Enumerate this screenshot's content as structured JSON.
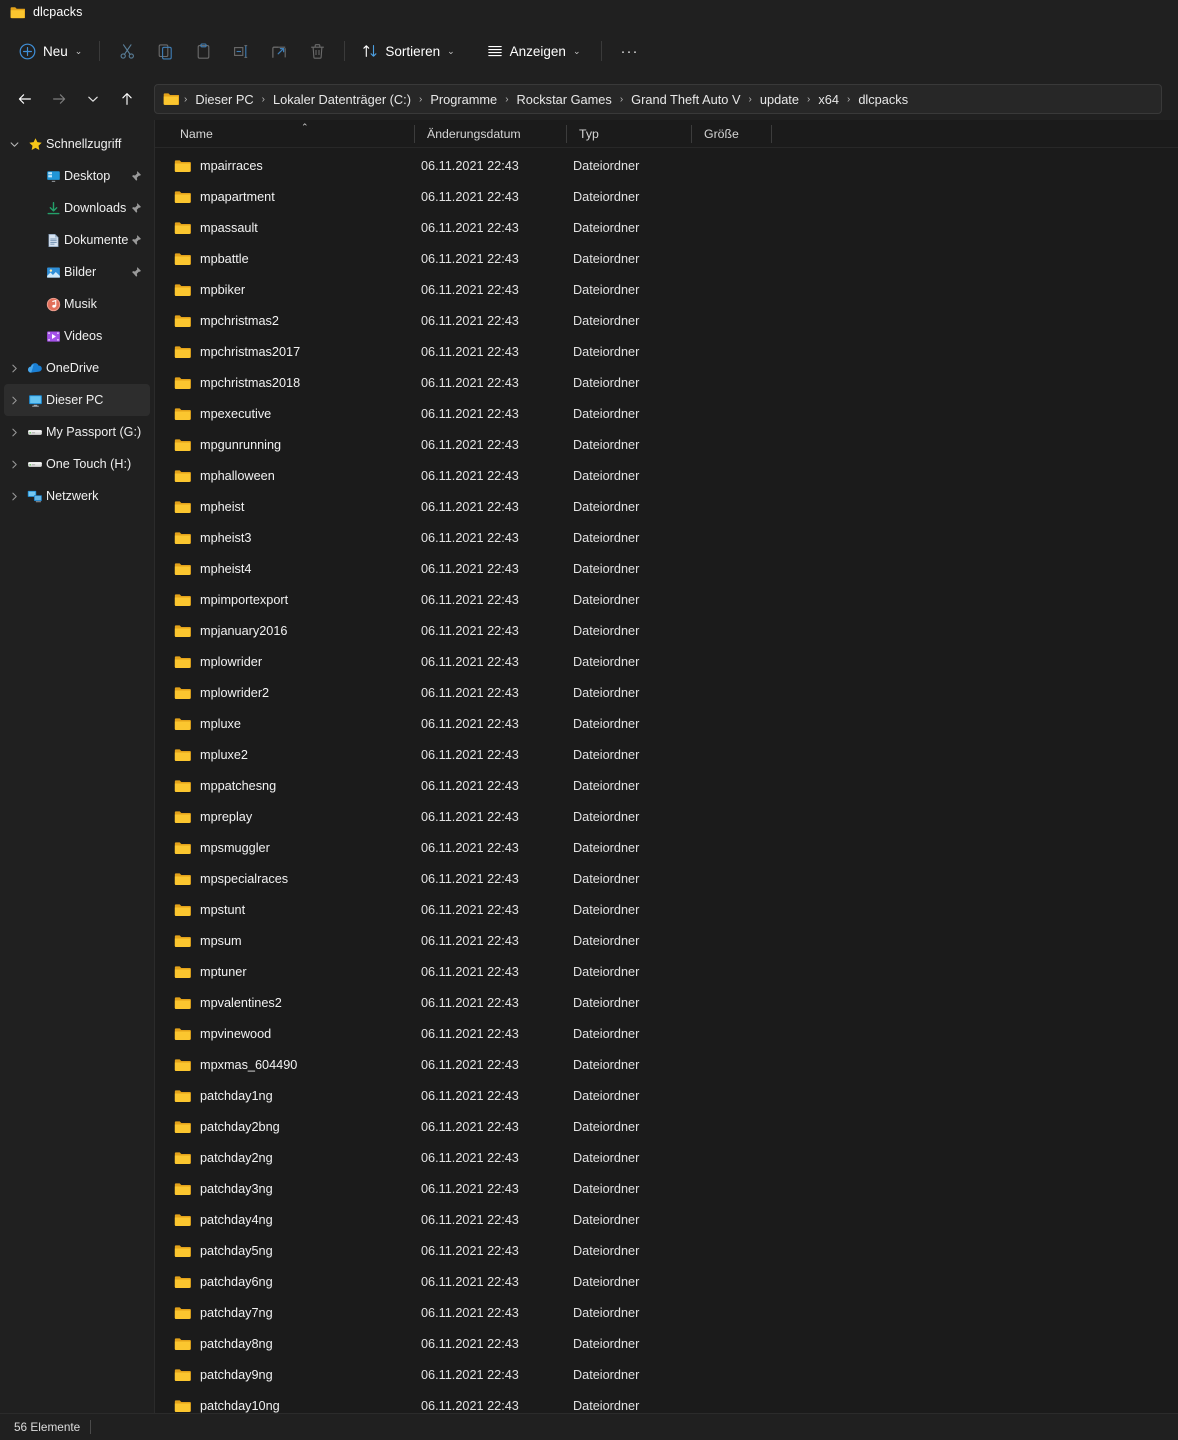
{
  "window": {
    "title": "dlcpacks",
    "folder_icon": "folder-icon"
  },
  "toolbar": {
    "new_label": "Neu",
    "new_icon": "plus-circle-icon",
    "cut_label": "Ausschneiden",
    "copy_label": "Kopieren",
    "paste_label": "Einfügen",
    "rename_label": "Umbenennen",
    "share_label": "Freigeben",
    "delete_label": "Löschen",
    "sort_label": "Sortieren",
    "sort_icon": "sort-arrows-icon",
    "view_label": "Anzeigen",
    "view_icon": "view-lines-icon",
    "more_label": "···"
  },
  "navbar": {
    "back_label": "Zurück",
    "forward_label": "Vorwärts",
    "recent_label": "Zuletzt verwendete Speicherorte",
    "up_label": "Nach oben",
    "breadcrumbs": [
      "Dieser PC",
      "Lokaler Datenträger (C:)",
      "Programme",
      "Rockstar Games",
      "Grand Theft Auto V",
      "update",
      "x64",
      "dlcpacks"
    ],
    "separator": "›"
  },
  "sidebar": {
    "items": [
      {
        "label": "Schnellzugriff",
        "icon": "star-icon",
        "expander": "down",
        "level": 0,
        "pinned": false,
        "selected": false
      },
      {
        "label": "Desktop",
        "icon": "desktop-icon",
        "expander": "none",
        "level": 1,
        "pinned": true,
        "selected": false
      },
      {
        "label": "Downloads",
        "icon": "download-icon",
        "expander": "none",
        "level": 1,
        "pinned": true,
        "selected": false
      },
      {
        "label": "Dokumente",
        "icon": "document-icon",
        "expander": "none",
        "level": 1,
        "pinned": true,
        "selected": false
      },
      {
        "label": "Bilder",
        "icon": "pictures-icon",
        "expander": "none",
        "level": 1,
        "pinned": true,
        "selected": false
      },
      {
        "label": "Musik",
        "icon": "music-icon",
        "expander": "none",
        "level": 1,
        "pinned": false,
        "selected": false
      },
      {
        "label": "Videos",
        "icon": "video-icon",
        "expander": "none",
        "level": 1,
        "pinned": false,
        "selected": false
      },
      {
        "label": "OneDrive",
        "icon": "cloud-icon",
        "expander": "right",
        "level": 0,
        "pinned": false,
        "selected": false
      },
      {
        "label": "Dieser PC",
        "icon": "monitor-icon",
        "expander": "right",
        "level": 0,
        "pinned": false,
        "selected": true
      },
      {
        "label": "My Passport (G:)",
        "icon": "drive-icon",
        "expander": "right",
        "level": 0,
        "pinned": false,
        "selected": false
      },
      {
        "label": "One Touch (H:)",
        "icon": "drive-icon",
        "expander": "right",
        "level": 0,
        "pinned": false,
        "selected": false
      },
      {
        "label": "Netzwerk",
        "icon": "network-icon",
        "expander": "right",
        "level": 0,
        "pinned": false,
        "selected": false
      }
    ]
  },
  "filelist": {
    "columns": [
      {
        "key": "name",
        "label": "Name",
        "sorted": "asc"
      },
      {
        "key": "date",
        "label": "Änderungsdatum",
        "sorted": "none"
      },
      {
        "key": "type",
        "label": "Typ",
        "sorted": "none"
      },
      {
        "key": "size",
        "label": "Größe",
        "sorted": "none"
      }
    ],
    "sort_indicator": "⌃",
    "rows": [
      {
        "name": "mpairraces",
        "date": "06.11.2021 22:43",
        "type": "Dateiordner",
        "size": ""
      },
      {
        "name": "mpapartment",
        "date": "06.11.2021 22:43",
        "type": "Dateiordner",
        "size": ""
      },
      {
        "name": "mpassault",
        "date": "06.11.2021 22:43",
        "type": "Dateiordner",
        "size": ""
      },
      {
        "name": "mpbattle",
        "date": "06.11.2021 22:43",
        "type": "Dateiordner",
        "size": ""
      },
      {
        "name": "mpbiker",
        "date": "06.11.2021 22:43",
        "type": "Dateiordner",
        "size": ""
      },
      {
        "name": "mpchristmas2",
        "date": "06.11.2021 22:43",
        "type": "Dateiordner",
        "size": ""
      },
      {
        "name": "mpchristmas2017",
        "date": "06.11.2021 22:43",
        "type": "Dateiordner",
        "size": ""
      },
      {
        "name": "mpchristmas2018",
        "date": "06.11.2021 22:43",
        "type": "Dateiordner",
        "size": ""
      },
      {
        "name": "mpexecutive",
        "date": "06.11.2021 22:43",
        "type": "Dateiordner",
        "size": ""
      },
      {
        "name": "mpgunrunning",
        "date": "06.11.2021 22:43",
        "type": "Dateiordner",
        "size": ""
      },
      {
        "name": "mphalloween",
        "date": "06.11.2021 22:43",
        "type": "Dateiordner",
        "size": ""
      },
      {
        "name": "mpheist",
        "date": "06.11.2021 22:43",
        "type": "Dateiordner",
        "size": ""
      },
      {
        "name": "mpheist3",
        "date": "06.11.2021 22:43",
        "type": "Dateiordner",
        "size": ""
      },
      {
        "name": "mpheist4",
        "date": "06.11.2021 22:43",
        "type": "Dateiordner",
        "size": ""
      },
      {
        "name": "mpimportexport",
        "date": "06.11.2021 22:43",
        "type": "Dateiordner",
        "size": ""
      },
      {
        "name": "mpjanuary2016",
        "date": "06.11.2021 22:43",
        "type": "Dateiordner",
        "size": ""
      },
      {
        "name": "mplowrider",
        "date": "06.11.2021 22:43",
        "type": "Dateiordner",
        "size": ""
      },
      {
        "name": "mplowrider2",
        "date": "06.11.2021 22:43",
        "type": "Dateiordner",
        "size": ""
      },
      {
        "name": "mpluxe",
        "date": "06.11.2021 22:43",
        "type": "Dateiordner",
        "size": ""
      },
      {
        "name": "mpluxe2",
        "date": "06.11.2021 22:43",
        "type": "Dateiordner",
        "size": ""
      },
      {
        "name": "mppatchesng",
        "date": "06.11.2021 22:43",
        "type": "Dateiordner",
        "size": ""
      },
      {
        "name": "mpreplay",
        "date": "06.11.2021 22:43",
        "type": "Dateiordner",
        "size": ""
      },
      {
        "name": "mpsmuggler",
        "date": "06.11.2021 22:43",
        "type": "Dateiordner",
        "size": ""
      },
      {
        "name": "mpspecialraces",
        "date": "06.11.2021 22:43",
        "type": "Dateiordner",
        "size": ""
      },
      {
        "name": "mpstunt",
        "date": "06.11.2021 22:43",
        "type": "Dateiordner",
        "size": ""
      },
      {
        "name": "mpsum",
        "date": "06.11.2021 22:43",
        "type": "Dateiordner",
        "size": ""
      },
      {
        "name": "mptuner",
        "date": "06.11.2021 22:43",
        "type": "Dateiordner",
        "size": ""
      },
      {
        "name": "mpvalentines2",
        "date": "06.11.2021 22:43",
        "type": "Dateiordner",
        "size": ""
      },
      {
        "name": "mpvinewood",
        "date": "06.11.2021 22:43",
        "type": "Dateiordner",
        "size": ""
      },
      {
        "name": "mpxmas_604490",
        "date": "06.11.2021 22:43",
        "type": "Dateiordner",
        "size": ""
      },
      {
        "name": "patchday1ng",
        "date": "06.11.2021 22:43",
        "type": "Dateiordner",
        "size": ""
      },
      {
        "name": "patchday2bng",
        "date": "06.11.2021 22:43",
        "type": "Dateiordner",
        "size": ""
      },
      {
        "name": "patchday2ng",
        "date": "06.11.2021 22:43",
        "type": "Dateiordner",
        "size": ""
      },
      {
        "name": "patchday3ng",
        "date": "06.11.2021 22:43",
        "type": "Dateiordner",
        "size": ""
      },
      {
        "name": "patchday4ng",
        "date": "06.11.2021 22:43",
        "type": "Dateiordner",
        "size": ""
      },
      {
        "name": "patchday5ng",
        "date": "06.11.2021 22:43",
        "type": "Dateiordner",
        "size": ""
      },
      {
        "name": "patchday6ng",
        "date": "06.11.2021 22:43",
        "type": "Dateiordner",
        "size": ""
      },
      {
        "name": "patchday7ng",
        "date": "06.11.2021 22:43",
        "type": "Dateiordner",
        "size": ""
      },
      {
        "name": "patchday8ng",
        "date": "06.11.2021 22:43",
        "type": "Dateiordner",
        "size": ""
      },
      {
        "name": "patchday9ng",
        "date": "06.11.2021 22:43",
        "type": "Dateiordner",
        "size": ""
      },
      {
        "name": "patchday10ng",
        "date": "06.11.2021 22:43",
        "type": "Dateiordner",
        "size": ""
      }
    ]
  },
  "statusbar": {
    "item_count": "56 Elemente"
  },
  "colors": {
    "window_bg": "#1b1b1b",
    "chrome_bg": "#202020",
    "selected_bg": "#2d2d2d",
    "accent_blue": "#4ca0e0",
    "folder_yellow": "#fbc62f",
    "text_primary": "#ffffff"
  }
}
